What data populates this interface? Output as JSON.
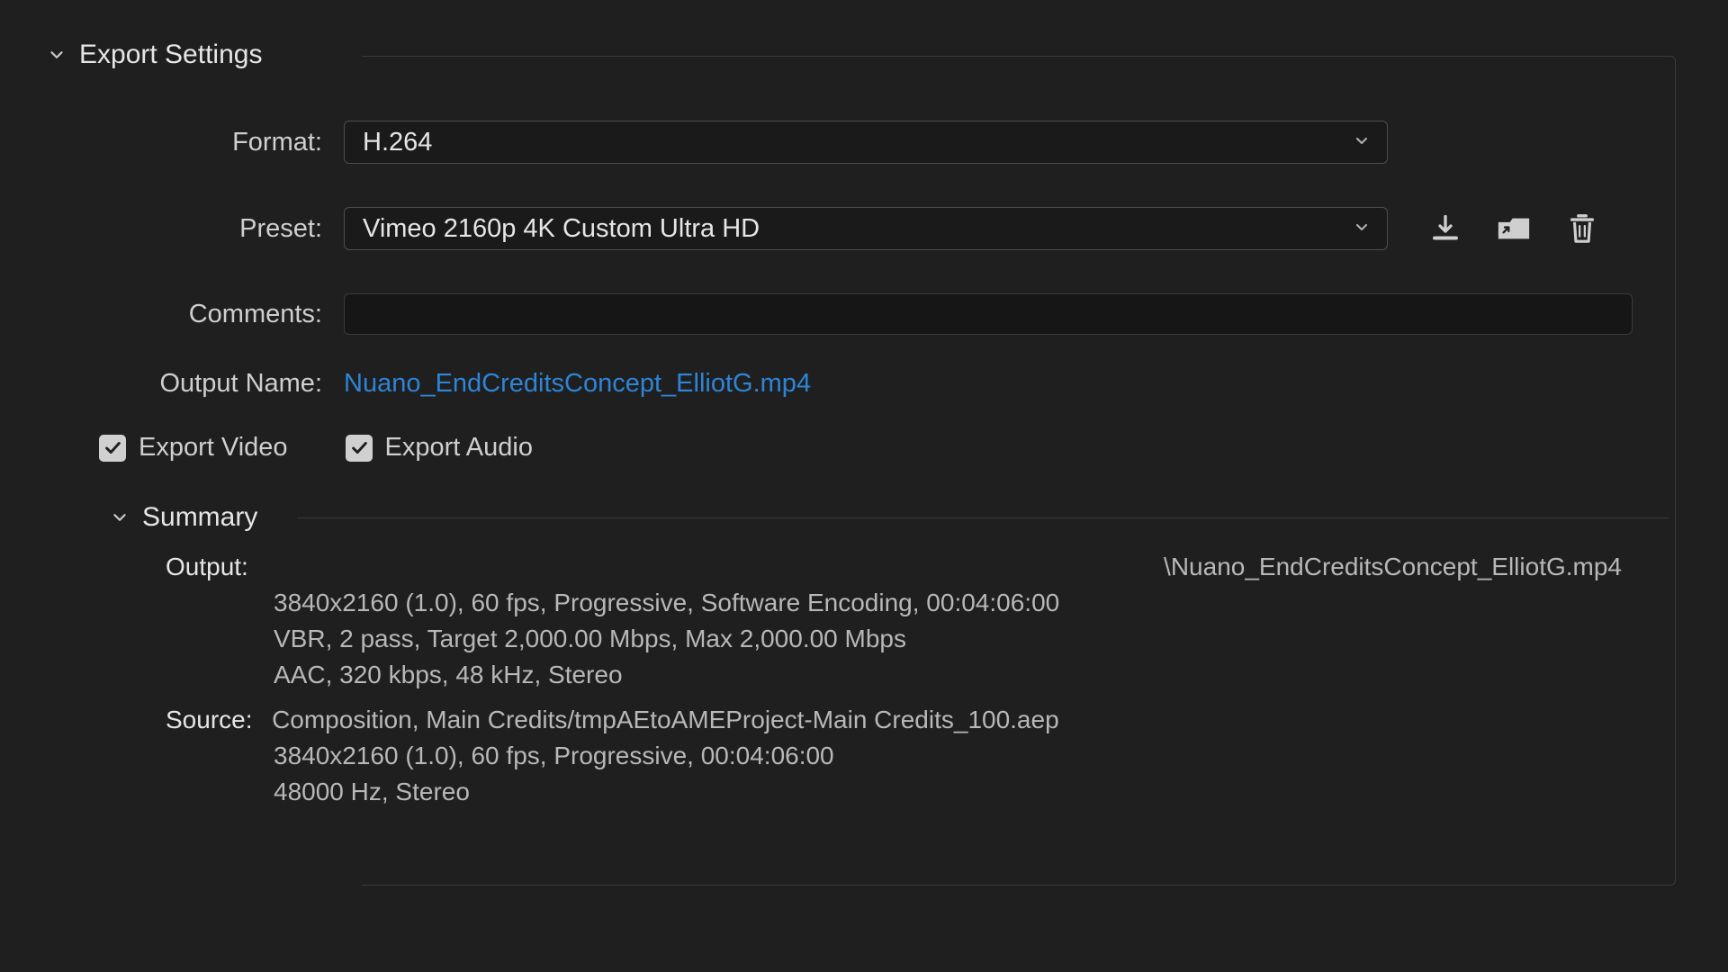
{
  "export_settings": {
    "section_title": "Export Settings",
    "format": {
      "label": "Format:",
      "value": "H.264"
    },
    "preset": {
      "label": "Preset:",
      "value": "Vimeo 2160p 4K Custom Ultra HD"
    },
    "comments": {
      "label": "Comments:",
      "value": ""
    },
    "output_name": {
      "label": "Output Name:",
      "value": "Nuano_EndCreditsConcept_ElliotG.mp4"
    },
    "export_video": {
      "label": "Export Video",
      "checked": true
    },
    "export_audio": {
      "label": "Export Audio",
      "checked": true
    },
    "icons": {
      "save_preset": "save-preset-icon",
      "import_preset": "import-preset-icon",
      "delete_preset": "delete-preset-icon"
    }
  },
  "summary": {
    "title": "Summary",
    "output": {
      "label": "Output:",
      "path": "\\Nuano_EndCreditsConcept_ElliotG.mp4",
      "line1": "3840x2160 (1.0), 60 fps, Progressive, Software Encoding, 00:04:06:00",
      "line2": "VBR, 2 pass, Target 2,000.00 Mbps, Max 2,000.00 Mbps",
      "line3": "AAC, 320 kbps, 48 kHz, Stereo"
    },
    "source": {
      "label": "Source:",
      "line1": "Composition, Main Credits/tmpAEtoAMEProject-Main Credits_100.aep",
      "line2": "3840x2160 (1.0), 60 fps, Progressive, 00:04:06:00",
      "line3": "48000 Hz, Stereo"
    }
  }
}
